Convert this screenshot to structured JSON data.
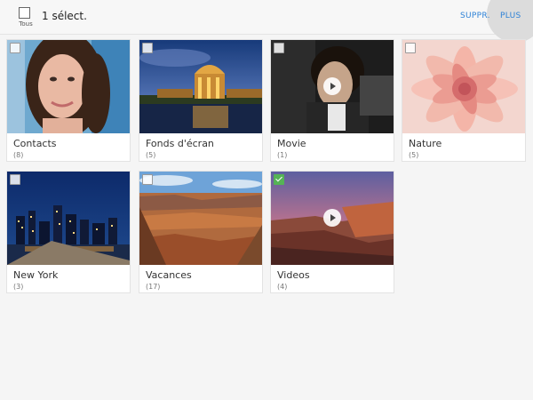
{
  "header": {
    "select_all_label": "Tous",
    "selection_text": "1 sélect.",
    "delete_label": "SUPPR.",
    "more_label": "PLUS"
  },
  "albums": [
    {
      "name": "Contacts",
      "count": "(8)",
      "selected": false,
      "video": false
    },
    {
      "name": "Fonds d'écran",
      "count": "(5)",
      "selected": false,
      "video": false
    },
    {
      "name": "Movie",
      "count": "(1)",
      "selected": false,
      "video": true
    },
    {
      "name": "Nature",
      "count": "(5)",
      "selected": false,
      "video": false
    },
    {
      "name": "New York",
      "count": "(3)",
      "selected": false,
      "video": false
    },
    {
      "name": "Vacances",
      "count": "(17)",
      "selected": false,
      "video": false
    },
    {
      "name": "Videos",
      "count": "(4)",
      "selected": true,
      "video": true
    }
  ],
  "colors": {
    "accent": "#2e82d6",
    "check_selected": "#55b356"
  }
}
